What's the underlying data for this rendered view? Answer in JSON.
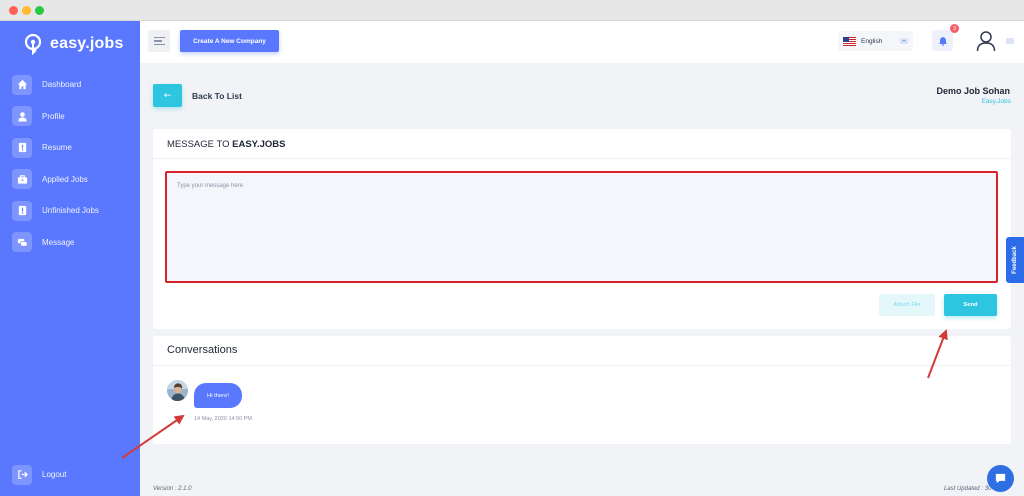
{
  "app": {
    "brand": "easy.jobs"
  },
  "sidebar": {
    "items": [
      {
        "label": "Dashboard",
        "icon": "home-icon"
      },
      {
        "label": "Profile",
        "icon": "user-icon"
      },
      {
        "label": "Resume",
        "icon": "resume-icon"
      },
      {
        "label": "Applied Jobs",
        "icon": "briefcase-icon"
      },
      {
        "label": "Unfinished Jobs",
        "icon": "document-icon"
      },
      {
        "label": "Message",
        "icon": "chat-icon"
      }
    ],
    "logout_label": "Logout"
  },
  "header": {
    "create_label": "Create A New Company",
    "language": "English",
    "notification_count": "3"
  },
  "page": {
    "back_label": "Back To List",
    "job_title": "Demo Job Sohan",
    "company": "Easy.Jobs"
  },
  "message": {
    "heading_prefix": "MESSAGE TO",
    "heading_bold": "EASY.JOBS",
    "placeholder": "Type your message here",
    "attach_label": "Attach File",
    "send_label": "Send"
  },
  "conversations": {
    "heading": "Conversations",
    "items": [
      {
        "text": "Hi there!",
        "time": "14 May, 2020 14:50 PM"
      }
    ]
  },
  "feedback_label": "Feedback",
  "footer": {
    "version": "Version : 2.1.0",
    "last_updated": "Last Updated : 30-04"
  },
  "colors": {
    "primary": "#5a78fe",
    "accent": "#2ec5e0",
    "highlight": "#d8222a",
    "annotation": "#d33a3a"
  }
}
